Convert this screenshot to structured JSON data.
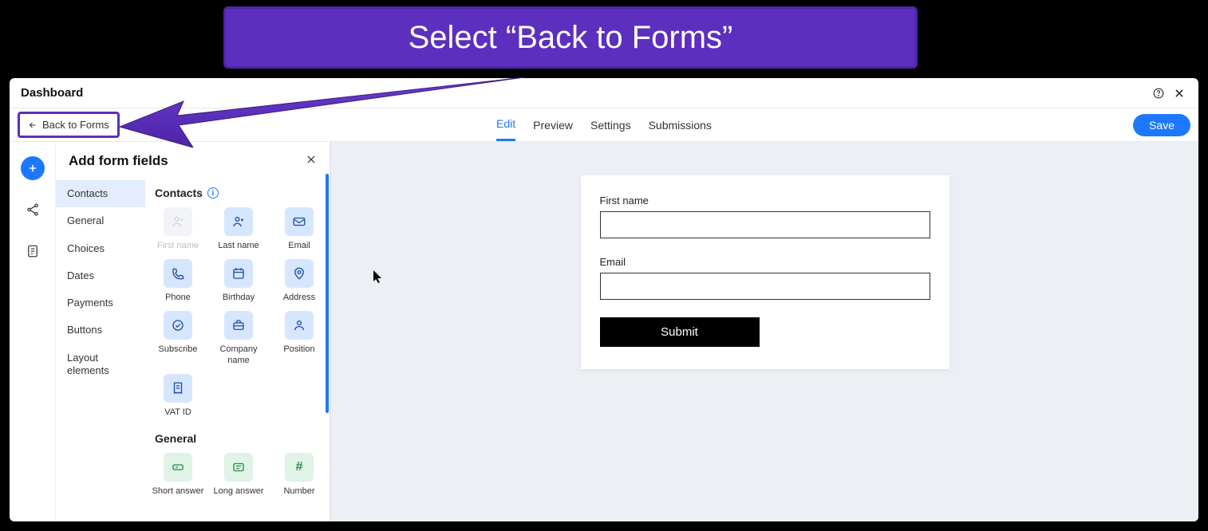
{
  "callout": {
    "text": "Select “Back to Forms”"
  },
  "titlebar": {
    "title": "Dashboard"
  },
  "navbar": {
    "back_label": "Back to Forms",
    "tabs": {
      "edit": "Edit",
      "preview": "Preview",
      "settings": "Settings",
      "submissions": "Submissions"
    },
    "save_label": "Save"
  },
  "panel": {
    "title": "Add form fields",
    "categories": {
      "contacts": "Contacts",
      "general": "General",
      "choices": "Choices",
      "dates": "Dates",
      "payments": "Payments",
      "buttons": "Buttons",
      "layout": "Layout elements"
    },
    "sections": {
      "contacts_title": "Contacts",
      "general_title": "General"
    },
    "tiles": {
      "first_name": "First name",
      "last_name": "Last name",
      "email": "Email",
      "phone": "Phone",
      "birthday": "Birthday",
      "address": "Address",
      "subscribe": "Subscribe",
      "company_name": "Company name",
      "position": "Position",
      "vat_id": "VAT ID",
      "short_answer": "Short answer",
      "long_answer": "Long answer",
      "number": "Number"
    }
  },
  "form_preview": {
    "first_name_label": "First name",
    "email_label": "Email",
    "submit_label": "Submit"
  }
}
